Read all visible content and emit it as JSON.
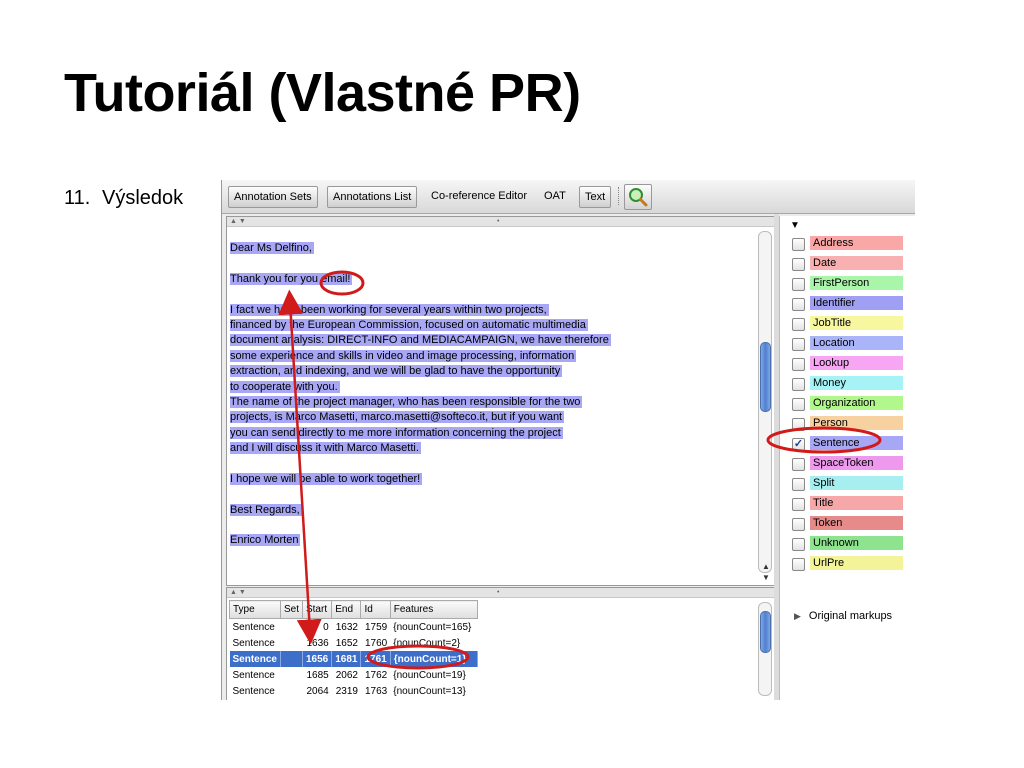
{
  "slide": {
    "title": "Tutoriál (Vlastné PR)",
    "step_number": "11.",
    "step_text": "Výsledok"
  },
  "toolbar": {
    "annotation_sets": "Annotation Sets",
    "annotations_list": "Annotations List",
    "coreference_editor": "Co-reference Editor",
    "oat": "OAT",
    "text": "Text",
    "search_icon": "magnifier-icon"
  },
  "document": {
    "lines": [
      "Dear Ms Delfino,",
      "",
      "Thank you for you email!",
      "",
      "I fact we have been working for several years within two projects,",
      "financed by the European Commission,  focused on automatic multimedia",
      "document analysis: DIRECT-INFO and MEDIACAMPAIGN, we have therefore",
      "some experience and skills in video and image processing, information",
      "extraction, and indexing, and we will be glad to have the opportunity",
      "to cooperate with you.",
      "The name of the project manager, who has been responsible for the two",
      "projects, is Marco Masetti, marco.masetti@softeco.it, but if you want",
      "you can send directly to me more information concerning the project",
      "and I will discuss it with Marco Masetti.",
      "",
      "I hope we will be able to work together!",
      "",
      "Best Regards,",
      "",
      "Enrico Morten"
    ]
  },
  "annotations": {
    "headers": [
      "Type",
      "Set",
      "Start",
      "End",
      "Id",
      "Features"
    ],
    "rows": [
      [
        "Sentence",
        "",
        "0",
        "1632",
        "1759",
        "{nounCount=165}"
      ],
      [
        "Sentence",
        "",
        "1636",
        "1652",
        "1760",
        "{nounCount=2}"
      ],
      [
        "Sentence",
        "",
        "1656",
        "1681",
        "1761",
        "{nounCount=1}"
      ],
      [
        "Sentence",
        "",
        "1685",
        "2062",
        "1762",
        "{nounCount=19}"
      ],
      [
        "Sentence",
        "",
        "2064",
        "2319",
        "1763",
        "{nounCount=13}"
      ]
    ],
    "selected_row": 2
  },
  "types": [
    {
      "label": "Address",
      "color": "#f9a7a7",
      "checked": false
    },
    {
      "label": "Date",
      "color": "#f9b0b0",
      "checked": false
    },
    {
      "label": "FirstPerson",
      "color": "#a9f5a9",
      "checked": false
    },
    {
      "label": "Identifier",
      "color": "#9f9ff4",
      "checked": false
    },
    {
      "label": "JobTitle",
      "color": "#f7f7a0",
      "checked": false
    },
    {
      "label": "Location",
      "color": "#aab4f8",
      "checked": false
    },
    {
      "label": "Lookup",
      "color": "#f7a6f3",
      "checked": false
    },
    {
      "label": "Money",
      "color": "#a6f3f7",
      "checked": false
    },
    {
      "label": "Organization",
      "color": "#b2f78c",
      "checked": false
    },
    {
      "label": "Person",
      "color": "#f7d2a0",
      "checked": false
    },
    {
      "label": "Sentence",
      "color": "#a7a7f6",
      "checked": true
    },
    {
      "label": "SpaceToken",
      "color": "#ee99ee",
      "checked": false
    },
    {
      "label": "Split",
      "color": "#a6eef0",
      "checked": false
    },
    {
      "label": "Title",
      "color": "#f6a8a8",
      "checked": false
    },
    {
      "label": "Token",
      "color": "#e68a8a",
      "checked": false
    },
    {
      "label": "Unknown",
      "color": "#8ee38e",
      "checked": false
    },
    {
      "label": "UrlPre",
      "color": "#f3f39a",
      "checked": false
    }
  ],
  "original_markups": "Original markups",
  "colors": {
    "highlight": "#a7a7f6",
    "selection": "#3d6ec9",
    "callout": "#d11a1a"
  }
}
